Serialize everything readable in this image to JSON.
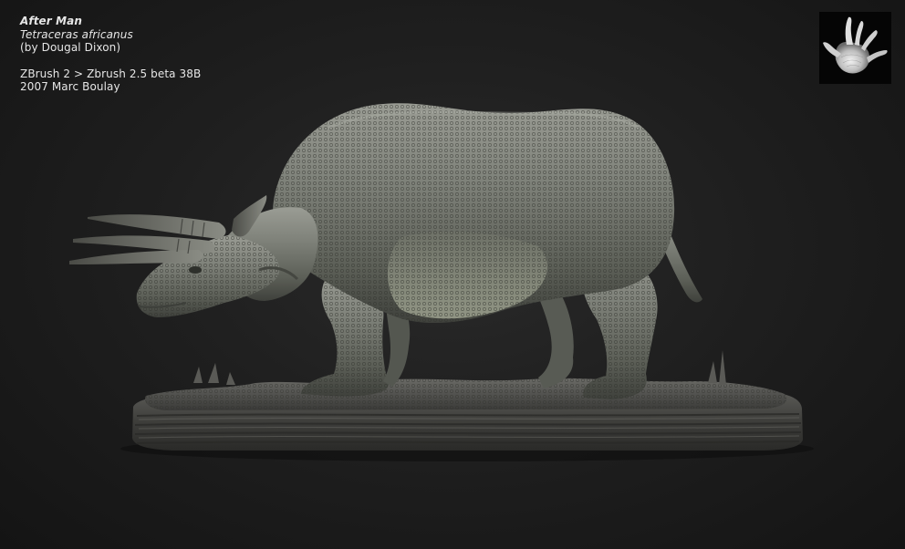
{
  "caption": {
    "title": "After Man",
    "species": "Tetraceras africanus",
    "author": "(by Dougal Dixon)",
    "software": "ZBrush 2 > Zbrush 2.5 beta 38B",
    "credit": "2007 Marc Boulay"
  },
  "logo": {
    "icon": "hand-print-icon"
  },
  "scene": {
    "subject": "tetraceras-sculpture",
    "base": "ground-base"
  },
  "colors": {
    "background": "#1f1f1f",
    "text": "#e6e6e6",
    "skin": "#7f827a",
    "base": "#4a4a47"
  }
}
